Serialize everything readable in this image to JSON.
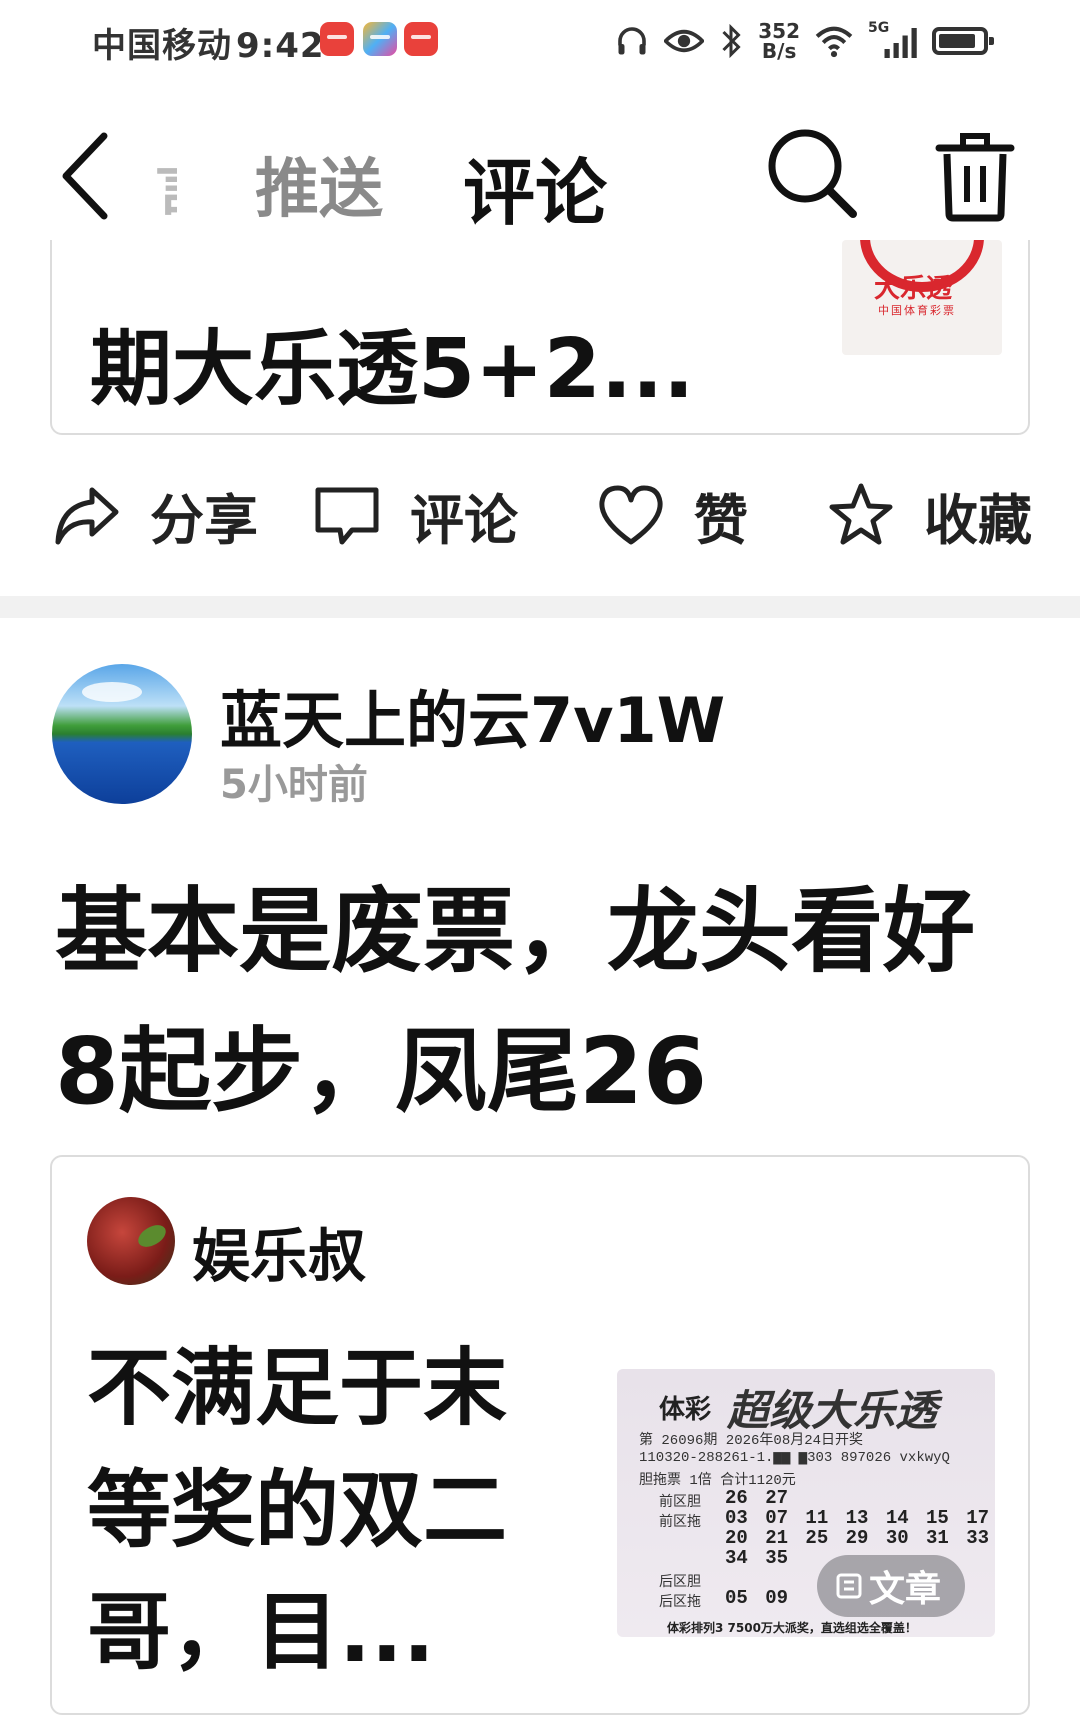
{
  "status_bar": {
    "carrier": "中国移动",
    "time": "9:42",
    "net_speed_value": "352",
    "net_speed_unit": "B/s",
    "network": "5G"
  },
  "nav": {
    "partial_tab": "言",
    "tab_push": "推送",
    "tab_comment": "评论"
  },
  "top_card": {
    "title": "期大乐透5+2...",
    "thumb_brand": "大乐透",
    "thumb_sub": "中国体育彩票"
  },
  "actions": {
    "share": "分享",
    "comment": "评论",
    "like": "赞",
    "favorite": "收藏"
  },
  "comment": {
    "username": "蓝天上的云7v1W",
    "time_ago": "5小时前",
    "text": "基本是废票，龙头看好8起步，凤尾26"
  },
  "quote": {
    "author": "娱乐叔",
    "text": "不满足于末等奖的双二哥，目...",
    "ticket": {
      "brand_small": "体彩",
      "brand_large": "超级大乐透",
      "issue_line": "第 26096期             2026年08月24日开奖",
      "serial_line": "110320-288261-1.▆▆ ▆303 897026  vxkwyQ",
      "type_line": "胆拖票            1倍           合计1120元",
      "front_dan_label": "前区胆",
      "front_dan": "26 27",
      "front_tuo_label": "前区拖",
      "front_tuo_1": "03 07 11 13 14 15 17",
      "front_tuo_2": "20 21 25 29 30 31 33",
      "front_tuo_3": "34 35",
      "back_dan_label": "后区胆",
      "back_tuo_label": "后区拖",
      "back_tuo": "05 09",
      "footer": "体彩排列3 7500万大派奖，直选组选全覆盖！"
    },
    "badge_label": "文章"
  }
}
